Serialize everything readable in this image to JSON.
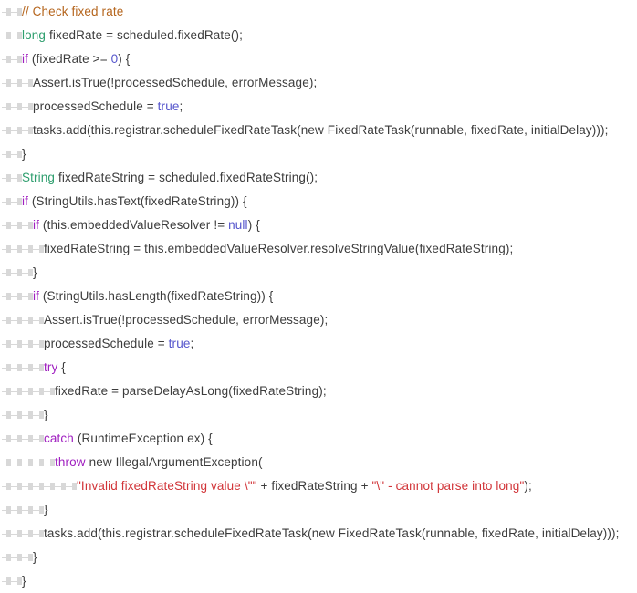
{
  "editor": {
    "name": "code-listing",
    "language": "java",
    "background_color": "#ffffff",
    "tab_indicator_color": "#d8d8d8",
    "line_height_px": 26,
    "font_size_px": 13.5,
    "total_lines": 24
  },
  "theme": {
    "plain": "#3c3c3c",
    "comment": "#b5651d",
    "type": "#2e9e6e",
    "keyword": "#a020c0",
    "this_new": "#cc33cc",
    "literal": "#5555cc",
    "string": "#d13438"
  },
  "lines": [
    {
      "n": 1,
      "indent": 2,
      "tokens": [
        {
          "t": "// Check fixed rate",
          "c": "comment"
        }
      ]
    },
    {
      "n": 2,
      "indent": 2,
      "tokens": [
        {
          "t": "long",
          "c": "type"
        },
        {
          "t": " fixedRate = scheduled.fixedRate();",
          "c": "plain"
        }
      ]
    },
    {
      "n": 3,
      "indent": 2,
      "tokens": [
        {
          "t": "if",
          "c": "keyword"
        },
        {
          "t": " (fixedRate >= ",
          "c": "plain"
        },
        {
          "t": "0",
          "c": "literal"
        },
        {
          "t": ") {",
          "c": "plain"
        }
      ]
    },
    {
      "n": 4,
      "indent": 3,
      "tokens": [
        {
          "t": "Assert.isTrue(!processedSchedule, errorMessage);",
          "c": "plain"
        }
      ]
    },
    {
      "n": 5,
      "indent": 3,
      "tokens": [
        {
          "t": "processedSchedule = ",
          "c": "plain"
        },
        {
          "t": "true",
          "c": "literal"
        },
        {
          "t": ";",
          "c": "plain"
        }
      ]
    },
    {
      "n": 6,
      "indent": 3,
      "tokens": [
        {
          "t": "tasks.add(",
          "c": "plain"
        },
        {
          "t": "this",
          "c": "this_new"
        },
        {
          "t": ".registrar.scheduleFixedRateTask(",
          "c": "plain"
        },
        {
          "t": "new",
          "c": "this_new"
        },
        {
          "t": " FixedRateTask(runnable, fixedRate, initialDelay)));",
          "c": "plain"
        }
      ]
    },
    {
      "n": 7,
      "indent": 2,
      "tokens": [
        {
          "t": "}",
          "c": "plain"
        }
      ]
    },
    {
      "n": 8,
      "indent": 2,
      "tokens": [
        {
          "t": "String",
          "c": "type"
        },
        {
          "t": " fixedRateString = scheduled.fixedRateString();",
          "c": "plain"
        }
      ]
    },
    {
      "n": 9,
      "indent": 2,
      "tokens": [
        {
          "t": "if",
          "c": "keyword"
        },
        {
          "t": " (StringUtils.hasText(fixedRateString)) {",
          "c": "plain"
        }
      ]
    },
    {
      "n": 10,
      "indent": 3,
      "tokens": [
        {
          "t": "if",
          "c": "keyword"
        },
        {
          "t": " (",
          "c": "plain"
        },
        {
          "t": "this",
          "c": "this_new"
        },
        {
          "t": ".embeddedValueResolver != ",
          "c": "plain"
        },
        {
          "t": "null",
          "c": "literal"
        },
        {
          "t": ") {",
          "c": "plain"
        }
      ]
    },
    {
      "n": 11,
      "indent": 4,
      "tokens": [
        {
          "t": "fixedRateString = ",
          "c": "plain"
        },
        {
          "t": "this",
          "c": "this_new"
        },
        {
          "t": ".embeddedValueResolver.resolveStringValue(fixedRateString);",
          "c": "plain"
        }
      ]
    },
    {
      "n": 12,
      "indent": 3,
      "tokens": [
        {
          "t": "}",
          "c": "plain"
        }
      ]
    },
    {
      "n": 13,
      "indent": 3,
      "tokens": [
        {
          "t": "if",
          "c": "keyword"
        },
        {
          "t": " (StringUtils.hasLength(fixedRateString)) {",
          "c": "plain"
        }
      ]
    },
    {
      "n": 14,
      "indent": 4,
      "tokens": [
        {
          "t": "Assert.isTrue(!processedSchedule, errorMessage);",
          "c": "plain"
        }
      ]
    },
    {
      "n": 15,
      "indent": 4,
      "tokens": [
        {
          "t": "processedSchedule = ",
          "c": "plain"
        },
        {
          "t": "true",
          "c": "literal"
        },
        {
          "t": ";",
          "c": "plain"
        }
      ]
    },
    {
      "n": 16,
      "indent": 4,
      "tokens": [
        {
          "t": "try",
          "c": "keyword"
        },
        {
          "t": " {",
          "c": "plain"
        }
      ]
    },
    {
      "n": 17,
      "indent": 5,
      "tokens": [
        {
          "t": "fixedRate = parseDelayAsLong(fixedRateString);",
          "c": "plain"
        }
      ]
    },
    {
      "n": 18,
      "indent": 4,
      "tokens": [
        {
          "t": "}",
          "c": "plain"
        }
      ]
    },
    {
      "n": 19,
      "indent": 4,
      "tokens": [
        {
          "t": "catch",
          "c": "keyword"
        },
        {
          "t": " (RuntimeException ex) {",
          "c": "plain"
        }
      ]
    },
    {
      "n": 20,
      "indent": 5,
      "tokens": [
        {
          "t": "throw",
          "c": "keyword"
        },
        {
          "t": " ",
          "c": "plain"
        },
        {
          "t": "new",
          "c": "this_new"
        },
        {
          "t": " IllegalArgumentException(",
          "c": "plain"
        }
      ]
    },
    {
      "n": 21,
      "indent": 7,
      "tokens": [
        {
          "t": "\"Invalid fixedRateString value \\\"\"",
          "c": "string"
        },
        {
          "t": " + fixedRateString + ",
          "c": "plain"
        },
        {
          "t": "\"\\\" - cannot parse into long\"",
          "c": "string"
        },
        {
          "t": ");",
          "c": "plain"
        }
      ]
    },
    {
      "n": 22,
      "indent": 4,
      "tokens": [
        {
          "t": "}",
          "c": "plain"
        }
      ]
    },
    {
      "n": 23,
      "indent": 4,
      "tokens": [
        {
          "t": "tasks.add(",
          "c": "plain"
        },
        {
          "t": "this",
          "c": "this_new"
        },
        {
          "t": ".registrar.scheduleFixedRateTask(",
          "c": "plain"
        },
        {
          "t": "new",
          "c": "this_new"
        },
        {
          "t": " FixedRateTask(runnable, fixedRate, initialDelay)));",
          "c": "plain"
        }
      ]
    },
    {
      "n": 24,
      "indent": 3,
      "tokens": [
        {
          "t": "}",
          "c": "plain"
        }
      ]
    },
    {
      "n": 25,
      "indent": 2,
      "tokens": [
        {
          "t": "}",
          "c": "plain"
        }
      ]
    }
  ]
}
